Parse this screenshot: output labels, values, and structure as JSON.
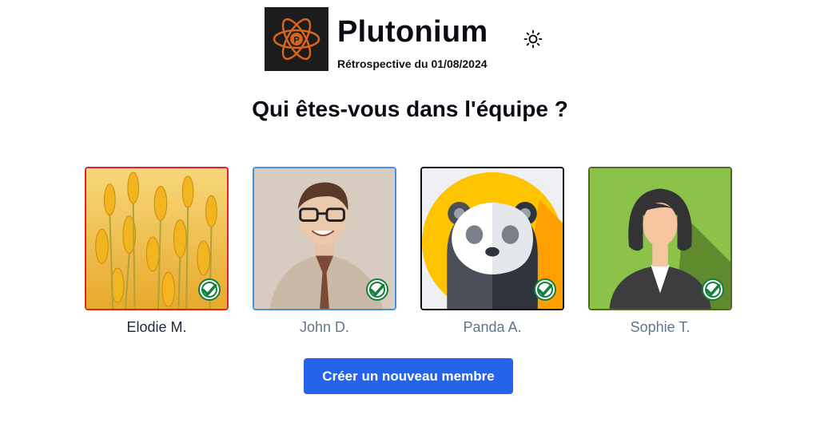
{
  "header": {
    "logo_letter": "P",
    "title": "Plutonium",
    "subtitle": "Rétrospective du 01/08/2024",
    "theme_icon": "sun-icon"
  },
  "main": {
    "question": "Qui êtes-vous dans l'équipe ?",
    "members": [
      {
        "name": "Elodie M.",
        "selected": true,
        "border": "#dc2626",
        "avatar": "wheat-field",
        "checked": true
      },
      {
        "name": "John D.",
        "selected": false,
        "border": "#4a90d9",
        "avatar": "smiling-man-with-glasses",
        "checked": true
      },
      {
        "name": "Panda A.",
        "selected": false,
        "border": "#111111",
        "avatar": "panda",
        "checked": true
      },
      {
        "name": "Sophie T.",
        "selected": false,
        "border": "#4d6b1f",
        "avatar": "woman-silhouette",
        "checked": true
      }
    ],
    "create_button": "Créer un nouveau membre"
  },
  "colors": {
    "accent": "#2563eb",
    "check": "#15803d",
    "selected_border": "#dc2626"
  }
}
